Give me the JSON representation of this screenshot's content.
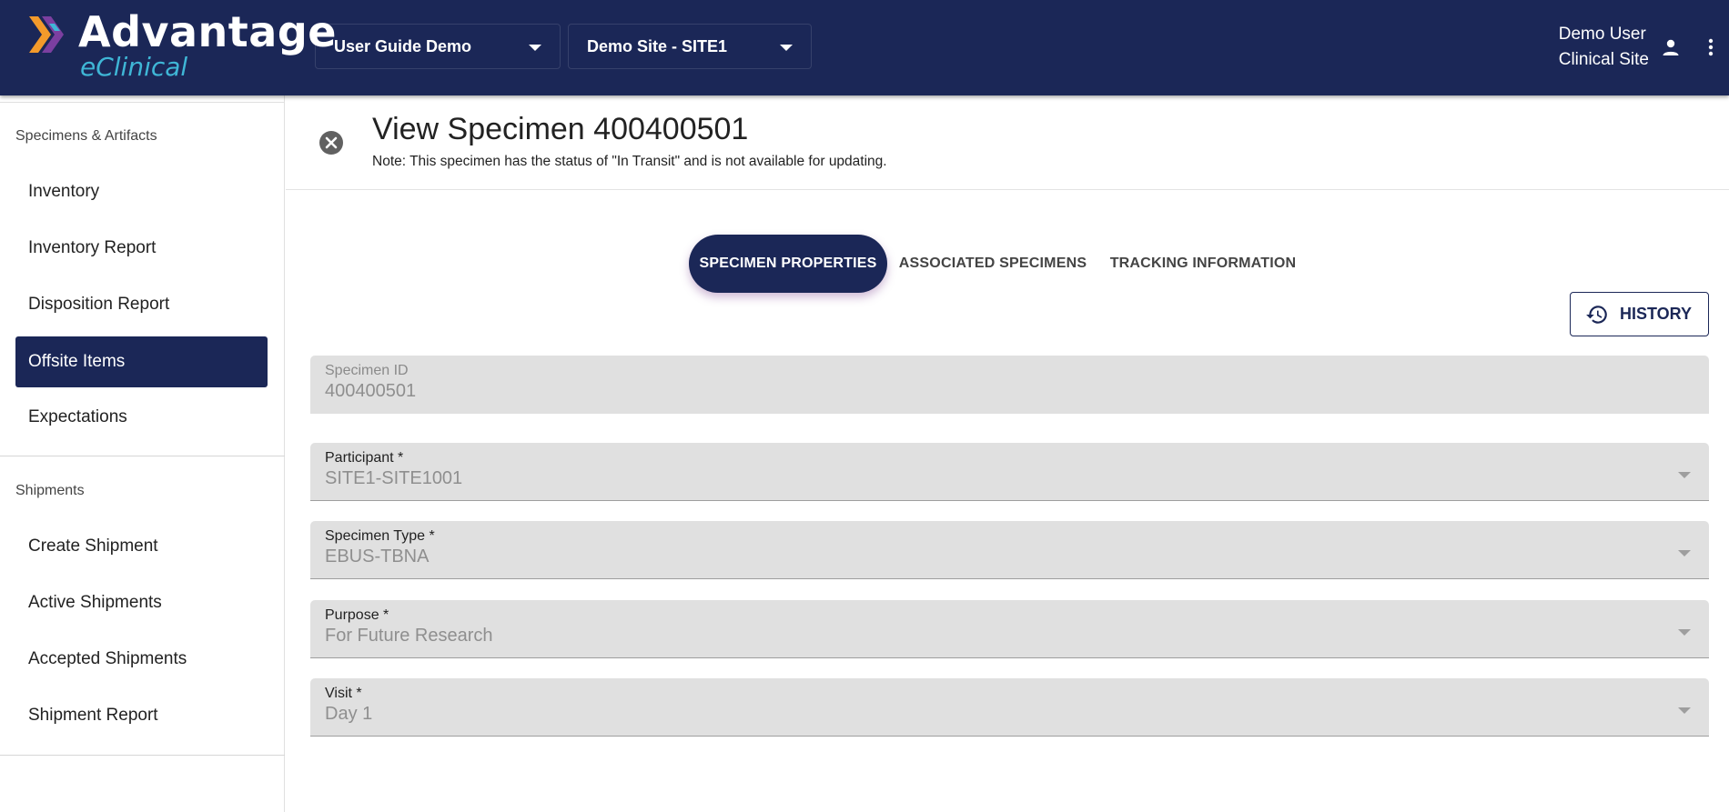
{
  "brand": {
    "name": "Advantage",
    "sub": "eClinical",
    "accent_orange": "#f39a2b",
    "accent_purple": "#7b3fa0",
    "accent_cyan": "#3fb6d6"
  },
  "colors": {
    "header_bg": "#1b2757",
    "active_bg": "#1b2757",
    "field_bg": "#e0e0e0"
  },
  "header": {
    "study_select": "User Guide Demo",
    "site_select": "Demo Site - SITE1",
    "user_name": "Demo User",
    "user_role": "Clinical Site",
    "user_icon": "person-icon",
    "menu_icon": "more-vert-icon"
  },
  "sidebar": {
    "section1_title": "Specimens & Artifacts",
    "section1_items": [
      {
        "label": "Inventory",
        "active": false
      },
      {
        "label": "Inventory Report",
        "active": false
      },
      {
        "label": "Disposition Report",
        "active": false
      },
      {
        "label": "Offsite Items",
        "active": true
      },
      {
        "label": "Expectations",
        "active": false
      }
    ],
    "section2_title": "Shipments",
    "section2_items": [
      {
        "label": "Create Shipment",
        "active": false
      },
      {
        "label": "Active Shipments",
        "active": false
      },
      {
        "label": "Accepted Shipments",
        "active": false
      },
      {
        "label": "Shipment Report",
        "active": false
      }
    ]
  },
  "main": {
    "title": "View Specimen 400400501",
    "note": "Note: This specimen has the status of \"In Transit\" and is not available for updating.",
    "close_icon": "close-circle-icon",
    "tabs": [
      {
        "label": "SPECIMEN PROPERTIES",
        "active": true
      },
      {
        "label": "ASSOCIATED SPECIMENS",
        "active": false
      },
      {
        "label": "TRACKING INFORMATION",
        "active": false
      }
    ],
    "history_button": "HISTORY",
    "history_icon": "history-icon",
    "fields": {
      "specimen_id": {
        "label": "Specimen ID",
        "value": "400400501"
      },
      "participant": {
        "label": "Participant *",
        "value": "SITE1-SITE1001"
      },
      "specimen_type": {
        "label": "Specimen Type *",
        "value": "EBUS-TBNA"
      },
      "purpose": {
        "label": "Purpose *",
        "value": "For Future Research"
      },
      "visit": {
        "label": "Visit *",
        "value": "Day 1"
      }
    }
  }
}
